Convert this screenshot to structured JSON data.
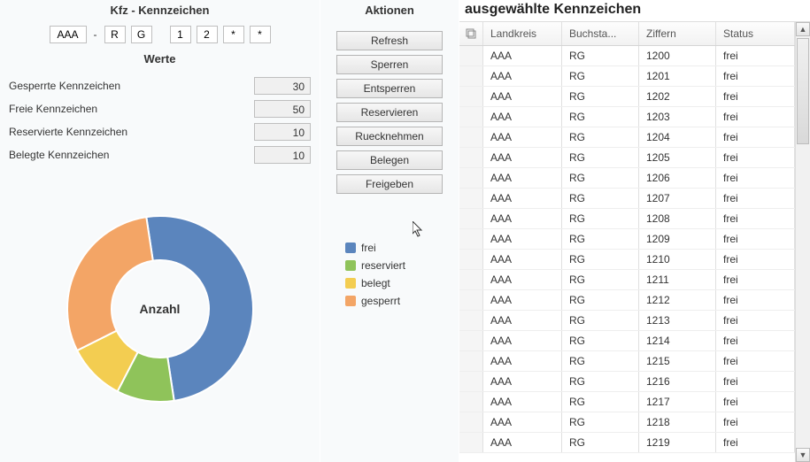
{
  "header_left": "Kfz - Kennzeichen",
  "header_center": "Aktionen",
  "header_right": "ausgewählte Kennzeichen",
  "werte_label": "Werte",
  "inputs": {
    "landkreis": "AAA",
    "dash": "-",
    "b1": "R",
    "b2": "G",
    "d1": "1",
    "d2": "2",
    "d3": "*",
    "d4": "*"
  },
  "werte": [
    {
      "label": "Gesperrte Kennzeichen",
      "value": "30"
    },
    {
      "label": "Freie Kennzeichen",
      "value": "50"
    },
    {
      "label": "Reservierte Kennzeichen",
      "value": "10"
    },
    {
      "label": "Belegte Kennzeichen",
      "value": "10"
    }
  ],
  "center_label": "Anzahl",
  "buttons": [
    "Refresh",
    "Sperren",
    "Entsperren",
    "Reservieren",
    "Ruecknehmen",
    "Belegen",
    "Freigeben"
  ],
  "legend": [
    {
      "label": "frei",
      "color": "#5b85bd"
    },
    {
      "label": "reserviert",
      "color": "#8fc35a"
    },
    {
      "label": "belegt",
      "color": "#f3cd51"
    },
    {
      "label": "gesperrt",
      "color": "#f3a566"
    }
  ],
  "chart_data": {
    "type": "pie",
    "title": "Anzahl",
    "series": [
      {
        "name": "frei",
        "value": 50,
        "color": "#5b85bd"
      },
      {
        "name": "reserviert",
        "value": 10,
        "color": "#8fc35a"
      },
      {
        "name": "belegt",
        "value": 10,
        "color": "#f3cd51"
      },
      {
        "name": "gesperrt",
        "value": 30,
        "color": "#f3a566"
      }
    ],
    "donut": true
  },
  "table": {
    "columns": [
      "Landkreis",
      "Buchsta...",
      "Ziffern",
      "Status"
    ],
    "rows": [
      [
        "AAA",
        "RG",
        "1200",
        "frei"
      ],
      [
        "AAA",
        "RG",
        "1201",
        "frei"
      ],
      [
        "AAA",
        "RG",
        "1202",
        "frei"
      ],
      [
        "AAA",
        "RG",
        "1203",
        "frei"
      ],
      [
        "AAA",
        "RG",
        "1204",
        "frei"
      ],
      [
        "AAA",
        "RG",
        "1205",
        "frei"
      ],
      [
        "AAA",
        "RG",
        "1206",
        "frei"
      ],
      [
        "AAA",
        "RG",
        "1207",
        "frei"
      ],
      [
        "AAA",
        "RG",
        "1208",
        "frei"
      ],
      [
        "AAA",
        "RG",
        "1209",
        "frei"
      ],
      [
        "AAA",
        "RG",
        "1210",
        "frei"
      ],
      [
        "AAA",
        "RG",
        "1211",
        "frei"
      ],
      [
        "AAA",
        "RG",
        "1212",
        "frei"
      ],
      [
        "AAA",
        "RG",
        "1213",
        "frei"
      ],
      [
        "AAA",
        "RG",
        "1214",
        "frei"
      ],
      [
        "AAA",
        "RG",
        "1215",
        "frei"
      ],
      [
        "AAA",
        "RG",
        "1216",
        "frei"
      ],
      [
        "AAA",
        "RG",
        "1217",
        "frei"
      ],
      [
        "AAA",
        "RG",
        "1218",
        "frei"
      ],
      [
        "AAA",
        "RG",
        "1219",
        "frei"
      ]
    ]
  }
}
